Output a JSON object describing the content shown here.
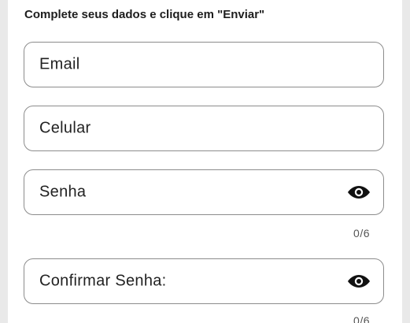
{
  "form": {
    "instructions": "Complete seus dados e clique em \"Enviar\"",
    "fields": [
      {
        "placeholder": "Email"
      },
      {
        "placeholder": "Celular"
      },
      {
        "placeholder": "Senha",
        "counter": "0/6",
        "icon": "eye-icon"
      },
      {
        "placeholder": "Confirmar Senha:",
        "counter": "0/6",
        "icon": "eye-icon"
      }
    ]
  }
}
